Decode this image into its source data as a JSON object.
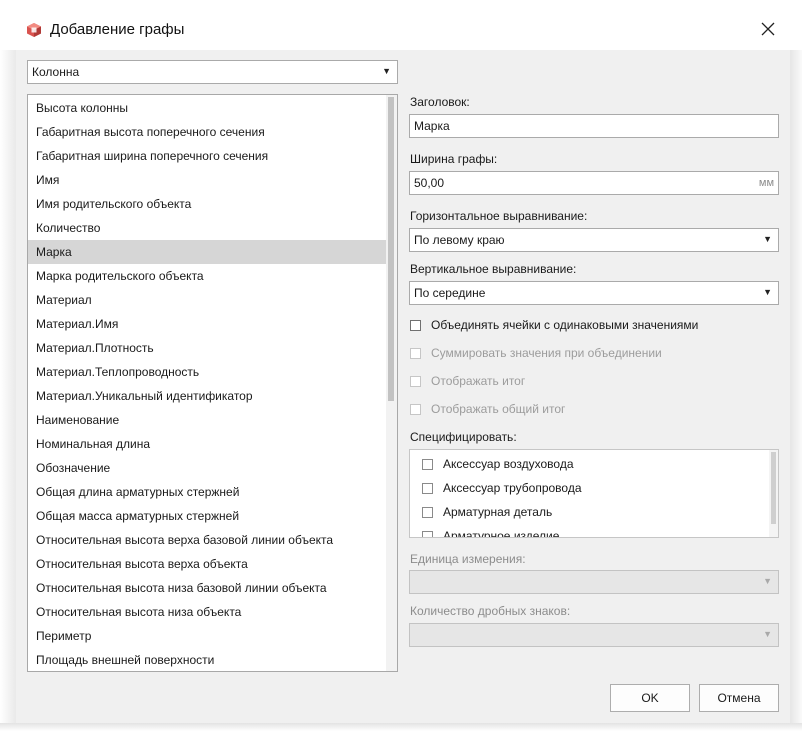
{
  "window": {
    "title": "Добавление графы"
  },
  "category_select": {
    "value": "Колонна"
  },
  "properties": {
    "items": [
      "Высота колонны",
      "Габаритная высота поперечного сечения",
      "Габаритная ширина поперечного сечения",
      "Имя",
      "Имя родительского объекта",
      "Количество",
      "Марка",
      "Марка родительского объекта",
      "Материал",
      "Материал.Имя",
      "Материал.Плотность",
      "Материал.Теплопроводность",
      "Материал.Уникальный идентификатор",
      "Наименование",
      "Номинальная длина",
      "Обозначение",
      "Общая длина арматурных стержней",
      "Общая масса арматурных стержней",
      "Относительная высота верха базовой линии объекта",
      "Относительная высота верха объекта",
      "Относительная высота низа базовой линии объекта",
      "Относительная высота низа объекта",
      "Периметр",
      "Площадь внешней поверхности"
    ],
    "selected": "Марка"
  },
  "header": {
    "label": "Заголовок:",
    "value": "Марка"
  },
  "width": {
    "label": "Ширина графы:",
    "value": "50,00",
    "unit": "мм"
  },
  "h_align": {
    "label": "Горизонтальное выравнивание:",
    "value": "По левому краю"
  },
  "v_align": {
    "label": "Вертикальное выравнивание:",
    "value": "По середине"
  },
  "options": {
    "merge": "Объединять ячейки с одинаковыми значениями",
    "sum": "Суммировать значения при объединении",
    "total": "Отображать итог",
    "grand_total": "Отображать общий итог"
  },
  "specify": {
    "label": "Специфицировать:",
    "items": [
      "Аксессуар воздуховода",
      "Аксессуар трубопровода",
      "Арматурная деталь",
      "Арматурное изделие"
    ]
  },
  "unit_field": {
    "label": "Единица измерения:"
  },
  "decimals_field": {
    "label": "Количество дробных знаков:"
  },
  "buttons": {
    "ok": "OK",
    "cancel": "Отмена"
  },
  "colors": {
    "selection": "#d6d6d6",
    "client_bg": "#f0f0f0"
  }
}
